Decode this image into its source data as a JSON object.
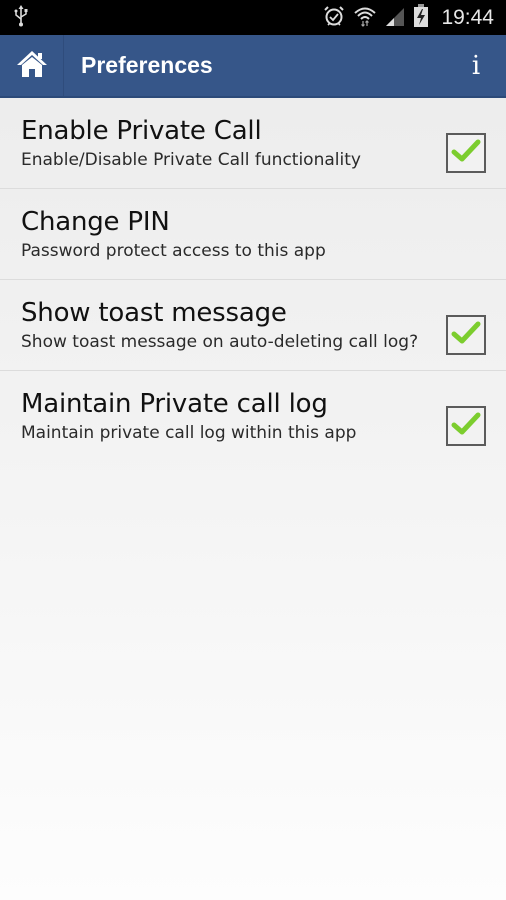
{
  "status_bar": {
    "left_icons": [
      "usb-icon"
    ],
    "right_icons": [
      "alarm-icon",
      "wifi-icon",
      "signal-icon",
      "battery-charging-icon"
    ],
    "time": "19:44"
  },
  "action_bar": {
    "home_icon": "home-icon",
    "title": "Preferences",
    "info_label": "i",
    "color": "#365689"
  },
  "preferences": [
    {
      "title": "Enable Private Call",
      "summary": "Enable/Disable Private Call functionality",
      "has_checkbox": true,
      "checked": true
    },
    {
      "title": "Change PIN",
      "summary": "Password protect access to this app",
      "has_checkbox": false
    },
    {
      "title": "Show toast message",
      "summary": "Show toast message on auto-deleting call log?",
      "has_checkbox": true,
      "checked": true
    },
    {
      "title": "Maintain Private call log",
      "summary": "Maintain private call log within this app",
      "has_checkbox": true,
      "checked": true
    }
  ],
  "checkmark_color": "#7ccd2e"
}
